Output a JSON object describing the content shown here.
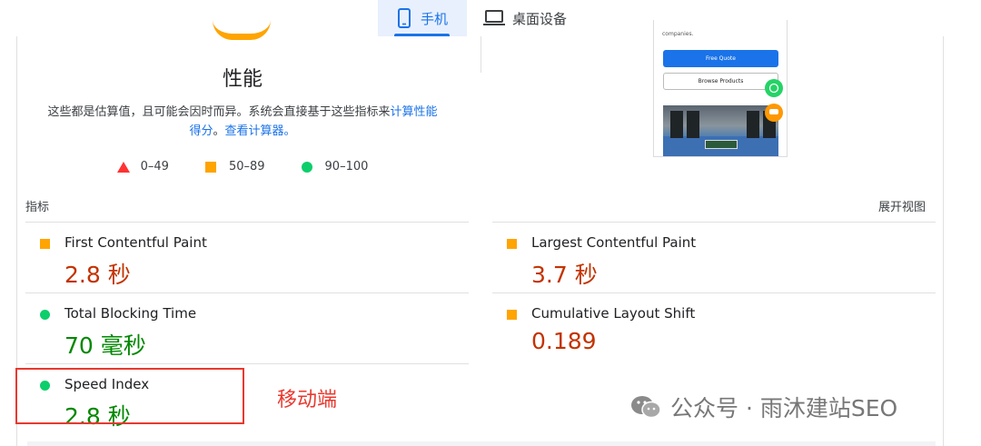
{
  "device_tabs": {
    "mobile": "手机",
    "desktop": "桌面设备"
  },
  "performance": {
    "title": "性能",
    "description_plain": "这些都是估算值，且可能会因时而异。系统会直接基于这些指标来",
    "description_link": "计算性能得分",
    "description_sep": "。",
    "calculator_link": "查看计算器。",
    "legend": {
      "fail": "0–49",
      "average": "50–89",
      "pass": "90–100"
    }
  },
  "preview": {
    "text": "companies.",
    "quote_button": "Free Quote",
    "browse_button": "Browse Products"
  },
  "metrics_section": {
    "label": "指标",
    "expand": "展开视图"
  },
  "metrics": {
    "fcp": {
      "name": "First Contentful Paint",
      "value": "2.8 秒",
      "status": "average"
    },
    "lcp": {
      "name": "Largest Contentful Paint",
      "value": "3.7 秒",
      "status": "average"
    },
    "tbt": {
      "name": "Total Blocking Time",
      "value": "70 毫秒",
      "status": "pass"
    },
    "cls": {
      "name": "Cumulative Layout Shift",
      "value": "0.189",
      "status": "average"
    },
    "si": {
      "name": "Speed Index",
      "value": "2.8 秒",
      "status": "pass"
    }
  },
  "annotation": "移动端",
  "watermark": "公众号 · 雨沐建站SEO",
  "colors": {
    "accent": "#1a73e8",
    "fail": "#ff3333",
    "average": "#ffa400",
    "pass": "#0cce6b",
    "annotation": "#e8392f"
  }
}
